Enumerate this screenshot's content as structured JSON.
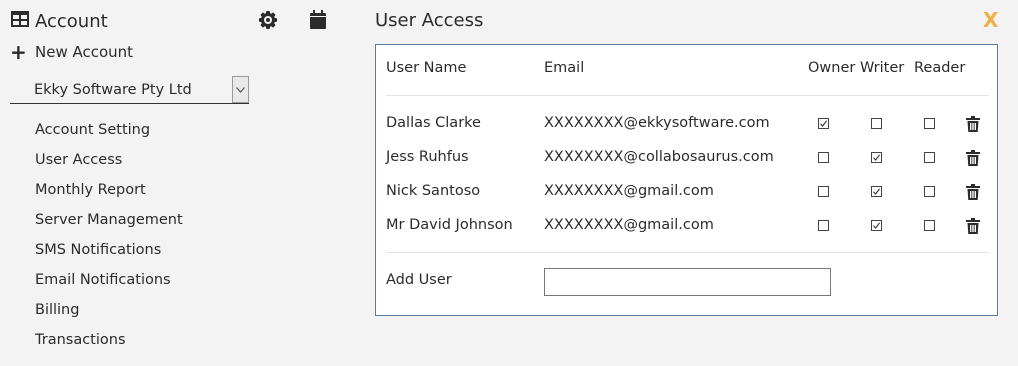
{
  "sidebar": {
    "title": "Account",
    "icons": [
      "grid-icon",
      "gear-icon",
      "calendar-icon"
    ],
    "new_account_label": "New Account",
    "selected_account": "Ekky Software Pty Ltd",
    "menu": [
      "Account Setting",
      "User Access",
      "Monthly Report",
      "Server Management",
      "SMS Notifications",
      "Email Notifications",
      "Billing",
      "Transactions"
    ]
  },
  "main": {
    "title": "User Access",
    "close_label": "X",
    "table": {
      "headers": [
        "User Name",
        "Email",
        "Owner",
        "Writer",
        "Reader"
      ],
      "rows": [
        {
          "name": "Dallas Clarke",
          "email": "XXXXXXXX@ekkysoftware.com",
          "owner": true,
          "writer": false,
          "reader": false
        },
        {
          "name": "Jess Ruhfus",
          "email": "XXXXXXXX@collabosaurus.com",
          "owner": false,
          "writer": true,
          "reader": false
        },
        {
          "name": "Nick Santoso",
          "email": "XXXXXXXX@gmail.com",
          "owner": false,
          "writer": true,
          "reader": false
        },
        {
          "name": "Mr David Johnson",
          "email": "XXXXXXXX@gmail.com",
          "owner": false,
          "writer": true,
          "reader": false
        }
      ]
    },
    "add_user_label": "Add User",
    "add_user_value": ""
  },
  "colors": {
    "accent": "#f0b048",
    "panel_border": "#5b7a9c",
    "background": "#f3f3f3"
  }
}
